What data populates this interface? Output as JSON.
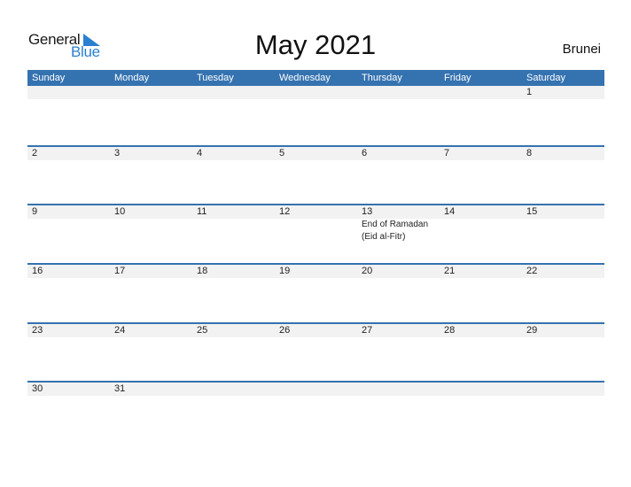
{
  "logo": {
    "word1": "General",
    "word2": "Blue"
  },
  "title": "May 2021",
  "country": "Brunei",
  "colors": {
    "header_bg": "#3572b0",
    "date_strip": "#f2f2f2",
    "logo_blue": "#2a7fd0"
  },
  "weekdays": [
    "Sunday",
    "Monday",
    "Tuesday",
    "Wednesday",
    "Thursday",
    "Friday",
    "Saturday"
  ],
  "weeks": [
    [
      {
        "day": ""
      },
      {
        "day": ""
      },
      {
        "day": ""
      },
      {
        "day": ""
      },
      {
        "day": ""
      },
      {
        "day": ""
      },
      {
        "day": "1"
      }
    ],
    [
      {
        "day": "2"
      },
      {
        "day": "3"
      },
      {
        "day": "4"
      },
      {
        "day": "5"
      },
      {
        "day": "6"
      },
      {
        "day": "7"
      },
      {
        "day": "8"
      }
    ],
    [
      {
        "day": "9"
      },
      {
        "day": "10"
      },
      {
        "day": "11"
      },
      {
        "day": "12"
      },
      {
        "day": "13",
        "events": [
          "End of Ramadan",
          "(Eid al-Fitr)"
        ]
      },
      {
        "day": "14"
      },
      {
        "day": "15"
      }
    ],
    [
      {
        "day": "16"
      },
      {
        "day": "17"
      },
      {
        "day": "18"
      },
      {
        "day": "19"
      },
      {
        "day": "20"
      },
      {
        "day": "21"
      },
      {
        "day": "22"
      }
    ],
    [
      {
        "day": "23"
      },
      {
        "day": "24"
      },
      {
        "day": "25"
      },
      {
        "day": "26"
      },
      {
        "day": "27"
      },
      {
        "day": "28"
      },
      {
        "day": "29"
      }
    ],
    [
      {
        "day": "30"
      },
      {
        "day": "31"
      },
      {
        "day": ""
      },
      {
        "day": ""
      },
      {
        "day": ""
      },
      {
        "day": ""
      },
      {
        "day": ""
      }
    ]
  ]
}
